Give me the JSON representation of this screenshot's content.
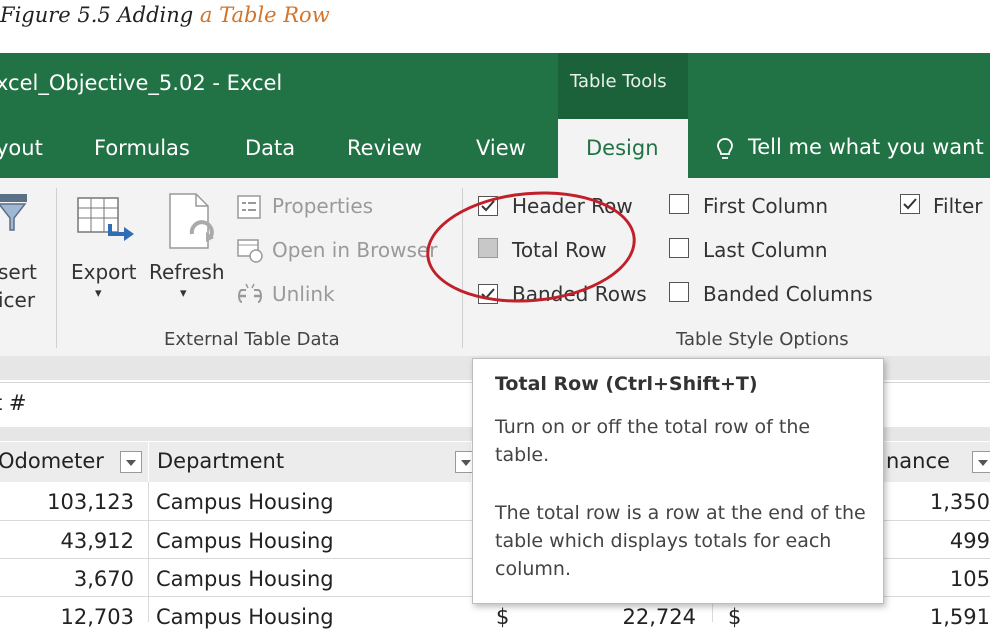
{
  "caption": {
    "prefix": "Figure 5.5 Adding ",
    "highlight": "a Table Row"
  },
  "titlebar": {
    "title": "xcel_Objective_5.02  -  Excel",
    "context_tab": "Table Tools"
  },
  "tabs": {
    "layout": "yout",
    "formulas": "Formulas",
    "data": "Data",
    "review": "Review",
    "view": "View",
    "design": "Design",
    "tell_me": "Tell me what you want t"
  },
  "ribbon": {
    "insert_slicer_line1": "sert",
    "insert_slicer_line2": "icer",
    "export": "Export",
    "refresh": "Refresh",
    "properties": "Properties",
    "open_in_browser": "Open in Browser",
    "unlink": "Unlink",
    "external_group": "External Table Data",
    "header_row": "Header Row",
    "total_row": "Total Row",
    "banded_rows": "Banded Rows",
    "first_column": "First Column",
    "last_column": "Last Column",
    "banded_columns": "Banded Columns",
    "filter": "Filter",
    "style_group": "Table Style Options"
  },
  "formula_bar": {
    "name_box": "t #"
  },
  "grid": {
    "col_odometer": "Odometer",
    "col_department": "Department",
    "col_maint": "nance",
    "rows": [
      {
        "odometer": "103,123",
        "department": "Campus Housing",
        "maint": "1,350"
      },
      {
        "odometer": "43,912",
        "department": "Campus Housing",
        "maint": "499"
      },
      {
        "odometer": "3,670",
        "department": "Campus Housing",
        "maint": "105"
      },
      {
        "odometer": "12,703",
        "department": "Campus Housing",
        "maint": "1,591",
        "cost_sym": "$",
        "cost": "22,724",
        "maint_sym": "$"
      }
    ]
  },
  "tooltip": {
    "title": "Total Row (Ctrl+Shift+T)",
    "line1": "Turn on or off the total row of the table.",
    "line2": "The total row is a row at the end of the table which displays totals for each column."
  }
}
